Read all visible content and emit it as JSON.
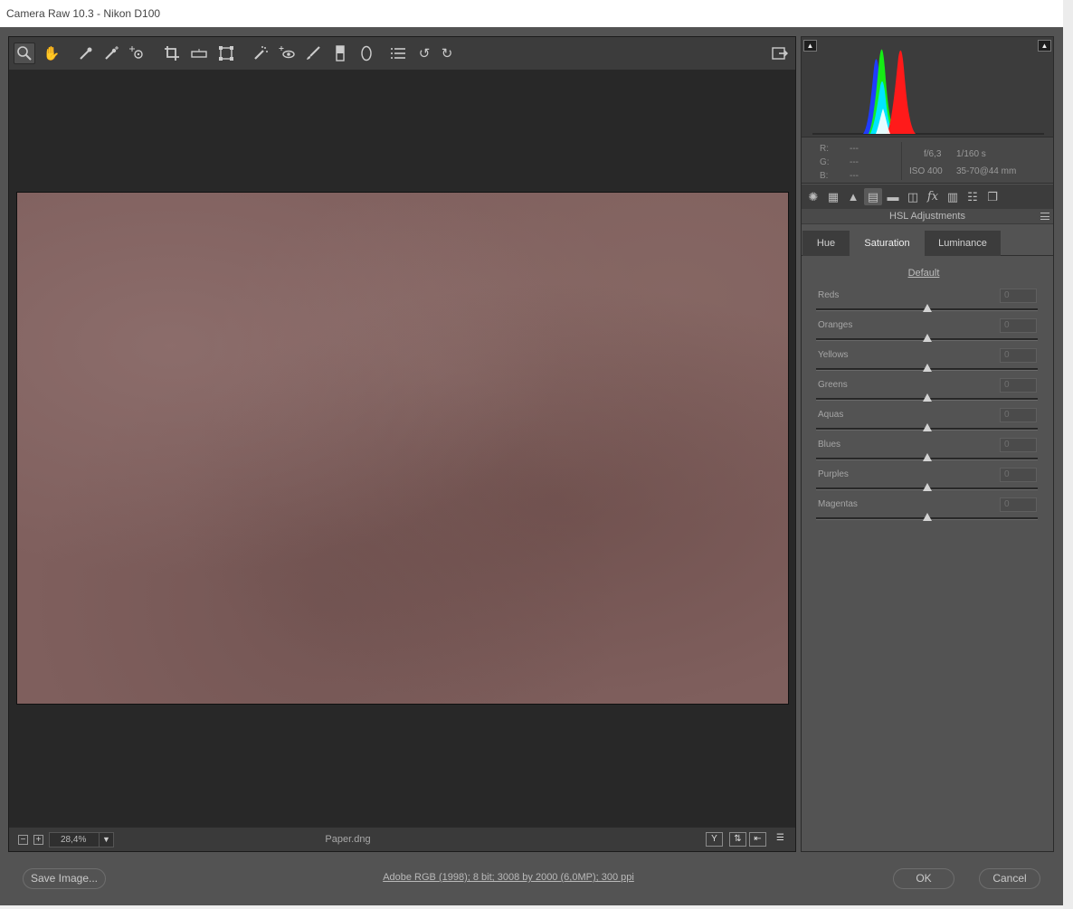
{
  "window": {
    "title": "Camera Raw 10.3  -  Nikon D100"
  },
  "toolbar": {
    "tools": [
      {
        "name": "zoom-tool",
        "icon": "magnifier-icon"
      },
      {
        "name": "hand-tool",
        "icon": "hand-icon"
      },
      {
        "name": "white-balance-tool",
        "icon": "eyedropper-icon"
      },
      {
        "name": "color-sampler-tool",
        "icon": "color-sampler-icon"
      },
      {
        "name": "targeted-adjustment-tool",
        "icon": "target-icon"
      },
      {
        "name": "crop-tool",
        "icon": "crop-icon"
      },
      {
        "name": "straighten-tool",
        "icon": "level-icon"
      },
      {
        "name": "transform-tool",
        "icon": "transform-icon"
      },
      {
        "name": "spot-removal-tool",
        "icon": "spot-brush-icon"
      },
      {
        "name": "red-eye-tool",
        "icon": "eye-icon"
      },
      {
        "name": "adjustment-brush-tool",
        "icon": "brush-icon"
      },
      {
        "name": "graduated-filter-tool",
        "icon": "gradient-icon"
      },
      {
        "name": "radial-filter-tool",
        "icon": "ellipse-icon"
      },
      {
        "name": "preferences-button",
        "icon": "list-icon"
      },
      {
        "name": "rotate-left-button",
        "icon": "rotate-ccw-icon"
      },
      {
        "name": "rotate-right-button",
        "icon": "rotate-cw-icon"
      }
    ],
    "fullscreen_icon": "fullscreen-toggle-icon"
  },
  "canvas": {
    "zoom": "28,4%",
    "filename": "Paper.dng"
  },
  "info": {
    "r_label": "R:",
    "r_value": "---",
    "g_label": "G:",
    "g_value": "---",
    "b_label": "B:",
    "b_value": "---",
    "aperture": "f/6,3",
    "shutter": "1/160 s",
    "iso": "ISO 400",
    "lens": "35-70@44 mm"
  },
  "panel": {
    "section_title": "HSL Adjustments",
    "subtabs": [
      "Hue",
      "Saturation",
      "Luminance"
    ],
    "active_subtab": "Saturation",
    "default_label": "Default",
    "sliders": [
      {
        "label": "Reds",
        "value": "0",
        "level": 0
      },
      {
        "label": "Oranges",
        "value": "0",
        "level": 0
      },
      {
        "label": "Yellows",
        "value": "0",
        "level": 0
      },
      {
        "label": "Greens",
        "value": "0",
        "level": 0
      },
      {
        "label": "Aquas",
        "value": "0",
        "level": 0
      },
      {
        "label": "Blues",
        "value": "0",
        "level": 0
      },
      {
        "label": "Purples",
        "value": "0",
        "level": 0
      },
      {
        "label": "Magentas",
        "value": "0",
        "level": 0
      }
    ],
    "slider_range": [
      -100,
      100
    ]
  },
  "bottom": {
    "save_label": "Save Image...",
    "workflow": "Adobe RGB (1998); 8 bit; 3008 by 2000 (6,0MP); 300 ppi",
    "ok_label": "OK",
    "cancel_label": "Cancel"
  },
  "colors": {
    "window_bg": "#535353",
    "canvas_bg": "#282828",
    "photo_tone": "#7f5f5d"
  }
}
